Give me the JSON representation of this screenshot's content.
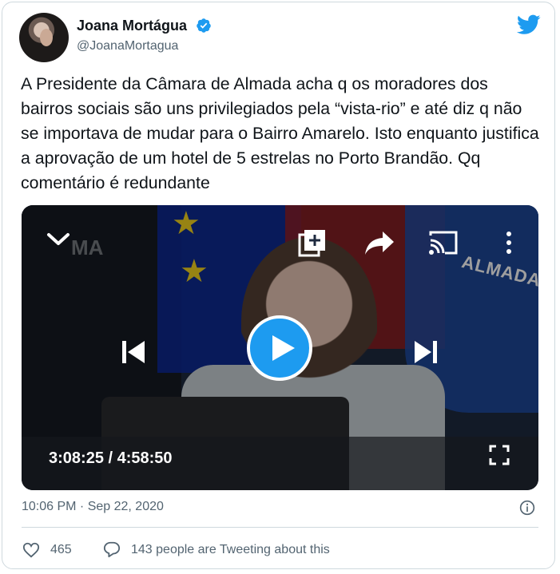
{
  "tweet": {
    "author_name": "Joana Mortágua",
    "author_handle": "@JoanaMortagua",
    "text": "A Presidente da Câmara de Almada acha q os moradores dos bairros sociais são uns privilegiados pela “vista-rio” e até diz q não se importava de mudar para o Bairro Amarelo. Isto enquanto justifica a aprovação de um hotel de 5 estrelas no Porto Brandão. Qq comentário é redundante",
    "timestamp": "10:06 PM · Sep 22, 2020",
    "likes": "465",
    "conversation": "143 people are Tweeting about this"
  },
  "video": {
    "current_time": "3:08:25",
    "duration": "4:58:50",
    "time_display": "3:08:25 / 4:58:50",
    "watermark": "MA",
    "flag_text": "ALMADA"
  },
  "colors": {
    "accent": "#1d9bf0",
    "text_primary": "#0f1419",
    "text_secondary": "#536471",
    "border": "#cfd9de"
  },
  "icons": [
    "verified-badge-icon",
    "twitter-bird-icon",
    "chevron-down-icon",
    "add-to-queue-icon",
    "share-icon",
    "cast-icon",
    "more-vertical-icon",
    "previous-icon",
    "play-icon",
    "next-icon",
    "fullscreen-icon",
    "info-icon",
    "heart-icon",
    "reply-bubble-icon"
  ]
}
